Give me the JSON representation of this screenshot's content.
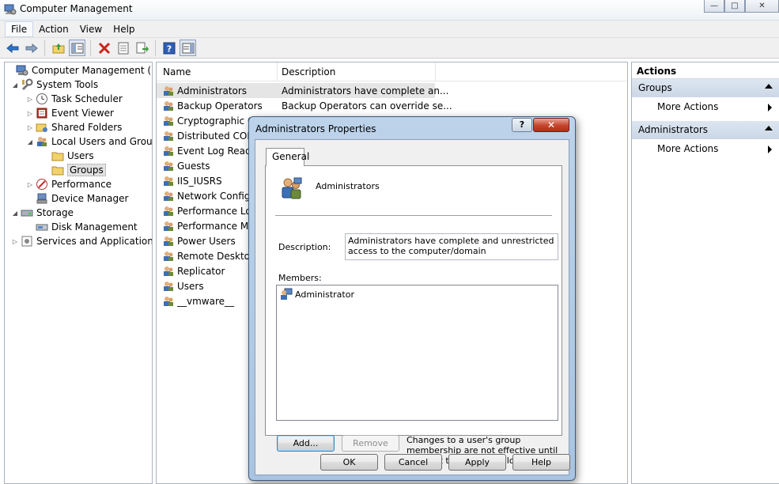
{
  "window": {
    "title": "Computer Management",
    "minimize": "—",
    "maximize": "□",
    "close": "✕"
  },
  "menu": [
    "File",
    "Action",
    "View",
    "Help"
  ],
  "toolbar": {
    "buttons": [
      "back-arrow-icon",
      "forward-arrow-icon",
      "up-folder-icon",
      "show-hide-tree-icon",
      "delete-icon",
      "properties-icon",
      "export-list-icon",
      "help-icon",
      "show-hide-action-pane-icon"
    ]
  },
  "tree": {
    "root": "Computer Management (Local",
    "system_tools": "System Tools",
    "task_scheduler": "Task Scheduler",
    "event_viewer": "Event Viewer",
    "shared_folders": "Shared Folders",
    "local_users_groups": "Local Users and Groups",
    "users": "Users",
    "groups": "Groups",
    "performance": "Performance",
    "device_manager": "Device Manager",
    "storage": "Storage",
    "disk_management": "Disk Management",
    "services_apps": "Services and Applications"
  },
  "list": {
    "columns": [
      "Name",
      "Description"
    ],
    "rows": [
      {
        "name": "Administrators",
        "desc": "Administrators have complete an..."
      },
      {
        "name": "Backup Operators",
        "desc": "Backup Operators can override se..."
      },
      {
        "name": "Cryptographic Op",
        "desc": ""
      },
      {
        "name": "Distributed COM",
        "desc": ""
      },
      {
        "name": "Event Log Readers",
        "desc": ""
      },
      {
        "name": "Guests",
        "desc": ""
      },
      {
        "name": "IIS_IUSRS",
        "desc": ""
      },
      {
        "name": "Network Configu",
        "desc": ""
      },
      {
        "name": "Performance Log",
        "desc": ""
      },
      {
        "name": "Performance Mor",
        "desc": ""
      },
      {
        "name": "Power Users",
        "desc": ""
      },
      {
        "name": "Remote Desktop U",
        "desc": ""
      },
      {
        "name": "Replicator",
        "desc": ""
      },
      {
        "name": "Users",
        "desc": ""
      },
      {
        "name": "__vmware__",
        "desc": ""
      }
    ]
  },
  "actions": {
    "header": "Actions",
    "sections": [
      {
        "title": "Groups",
        "item": "More Actions"
      },
      {
        "title": "Administrators",
        "item": "More Actions"
      }
    ]
  },
  "dialog": {
    "title": "Administrators Properties",
    "help": "?",
    "close": "✕",
    "tab": "General",
    "group_name": "Administrators",
    "description_label": "Description:",
    "description_value": "Administrators have complete and unrestricted access to the computer/domain",
    "members_label": "Members:",
    "members": [
      "Administrator"
    ],
    "add": "Add...",
    "remove": "Remove",
    "note": "Changes to a user's group membership are not effective until the next time the user logs on.",
    "ok": "OK",
    "cancel": "Cancel",
    "apply": "Apply",
    "help_button": "Help"
  }
}
